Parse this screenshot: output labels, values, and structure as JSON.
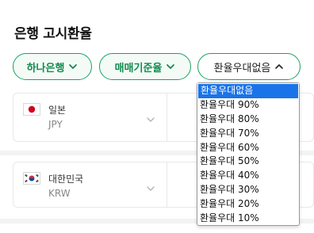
{
  "page": {
    "title": "은행 고시환율"
  },
  "filters": {
    "bank": "하나은행",
    "rate_type": "매매기준율",
    "discount": "환율우대없음"
  },
  "currencies": [
    {
      "name": "일본",
      "code": "JPY"
    },
    {
      "name": "대한민국",
      "code": "KRW"
    }
  ],
  "discount_options": [
    "환율우대없음",
    "환율우대 90%",
    "환율우대 80%",
    "환율우대 70%",
    "환율우대 60%",
    "환율우대 50%",
    "환율우대 40%",
    "환율우대 30%",
    "환율우대 20%",
    "환율우대 10%"
  ],
  "colors": {
    "accent": "#1aa260",
    "selection": "#1a73e8"
  },
  "icons": {
    "chip_chevron": "chevron-down-icon",
    "open_chevron": "chevron-up-icon"
  }
}
